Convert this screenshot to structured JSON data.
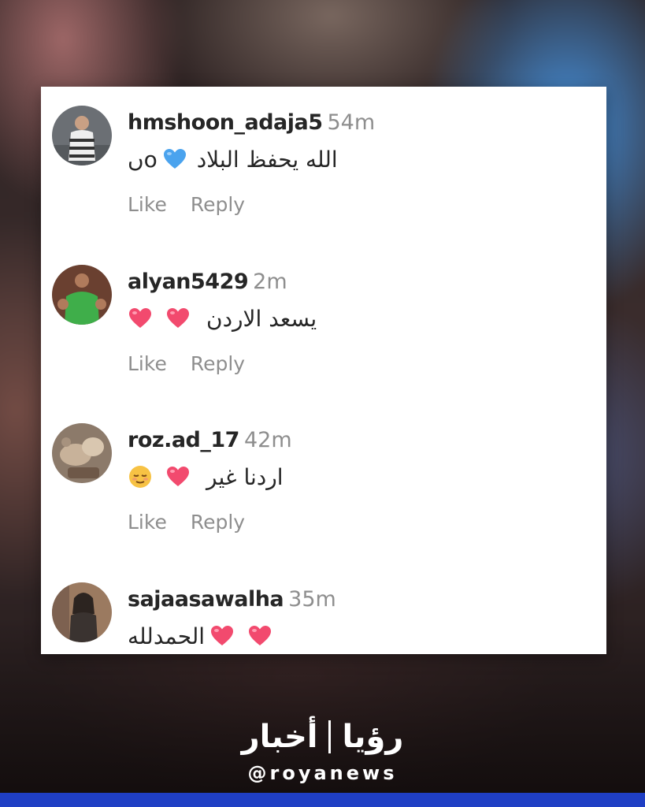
{
  "comments": [
    {
      "username": "hmshoon_adaja5",
      "time": "54m",
      "text": "الله يحفظ البلاد",
      "prefix": "ںο",
      "emojis": [
        "blue-heart"
      ],
      "like": "Like",
      "reply": "Reply"
    },
    {
      "username": "alyan5429",
      "time": "2m",
      "text": "يسعد الاردن",
      "emojis": [
        "pink-heart",
        "pink-heart"
      ],
      "like": "Like",
      "reply": "Reply"
    },
    {
      "username": "roz.ad_17",
      "time": "42m",
      "text": "اردنا غير",
      "emojis": [
        "relieved-face",
        "pink-heart"
      ],
      "like": "Like",
      "reply": "Reply"
    },
    {
      "username": "sajaasawalha",
      "time": "35m",
      "text": "الحمدلله",
      "emojis": [
        "pink-heart",
        "pink-heart"
      ]
    }
  ],
  "brand": {
    "logo_arabic": "رؤيا | أخبار",
    "logo_roya": "رؤيا",
    "logo_akhbar": "أخبار",
    "handle": "@royanews",
    "bar_color": "#1f3fc4"
  }
}
